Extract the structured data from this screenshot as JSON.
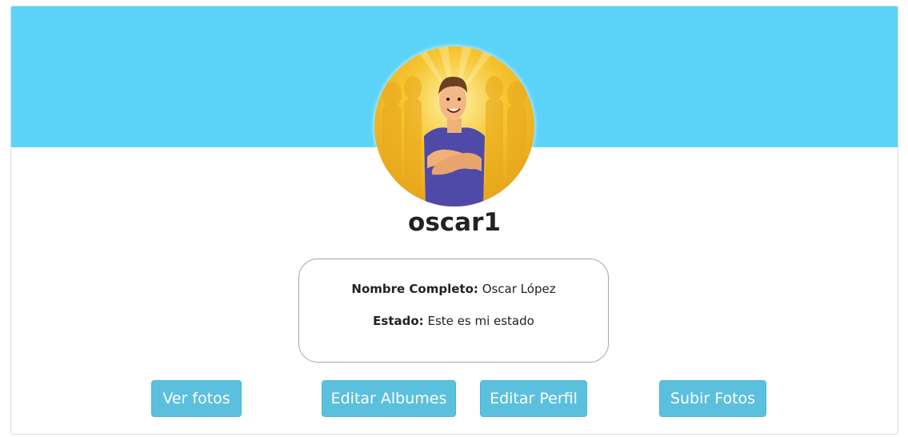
{
  "profile": {
    "username": "oscar1",
    "full_name_label": "Nombre Completo:",
    "full_name_value": "Oscar López",
    "status_label": "Estado:",
    "status_value": "Este es mi estado"
  },
  "actions": {
    "view_photos": "Ver fotos",
    "edit_albums": "Editar Albumes",
    "edit_profile": "Editar Perfil",
    "upload_photos": "Subir Fotos"
  },
  "colors": {
    "cover": "#5bd3f8",
    "button": "#5bc0de"
  }
}
